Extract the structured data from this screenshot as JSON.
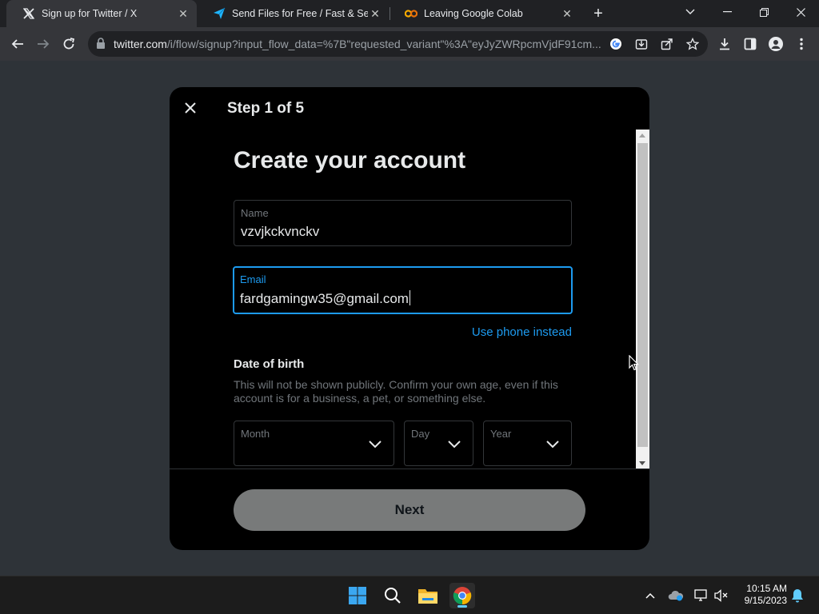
{
  "browser": {
    "tabs": [
      {
        "title": "Sign up for Twitter / X",
        "icon": "x-logo-icon",
        "active": true
      },
      {
        "title": "Send Files for Free / Fast & Secure",
        "icon": "paper-plane-icon",
        "active": false
      },
      {
        "title": "Leaving Google Colab",
        "icon": "colab-icon",
        "active": false
      }
    ],
    "url_host": "twitter.com",
    "url_path": "/i/flow/signup?input_flow_data=%7B\"requested_variant\"%3A\"eyJyZWRpcmVjdF91cm..."
  },
  "modal": {
    "step": "Step 1 of 5",
    "heading": "Create your account",
    "name_field": {
      "label": "Name",
      "value": "vzvjkckvnckv"
    },
    "email_field": {
      "label": "Email",
      "value": "fardgamingw35@gmail.com"
    },
    "use_phone": "Use phone instead",
    "dob": {
      "title": "Date of birth",
      "description": "This will not be shown publicly. Confirm your own age, even if this account is for a business, a pet, or something else.",
      "month_label": "Month",
      "day_label": "Day",
      "year_label": "Year"
    },
    "next_label": "Next"
  },
  "taskbar": {
    "time": "10:15 AM",
    "date": "9/15/2023"
  },
  "colors": {
    "accent": "#1d9bf0",
    "modal_bg": "#000000",
    "page_bg": "#2e3338",
    "next_button": "#787a7a"
  }
}
